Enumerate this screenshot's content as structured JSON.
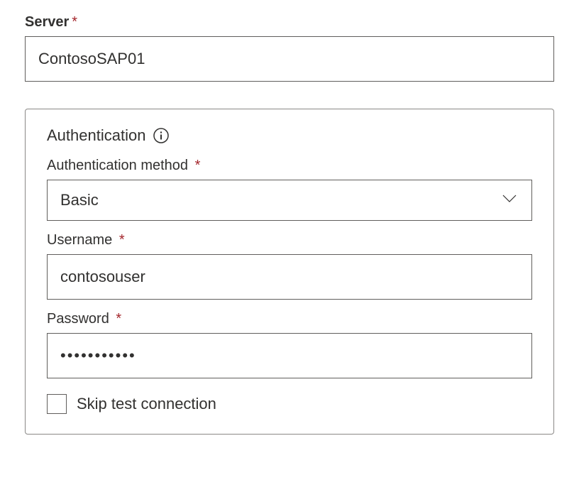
{
  "server": {
    "label": "Server",
    "value": "ContosoSAP01"
  },
  "auth": {
    "section_title": "Authentication",
    "method": {
      "label": "Authentication method",
      "selected": "Basic"
    },
    "username": {
      "label": "Username",
      "value": "contosouser"
    },
    "password": {
      "label": "Password",
      "masked_value": "•••••••••••"
    },
    "skip_test": {
      "label": "Skip test connection",
      "checked": false
    }
  }
}
